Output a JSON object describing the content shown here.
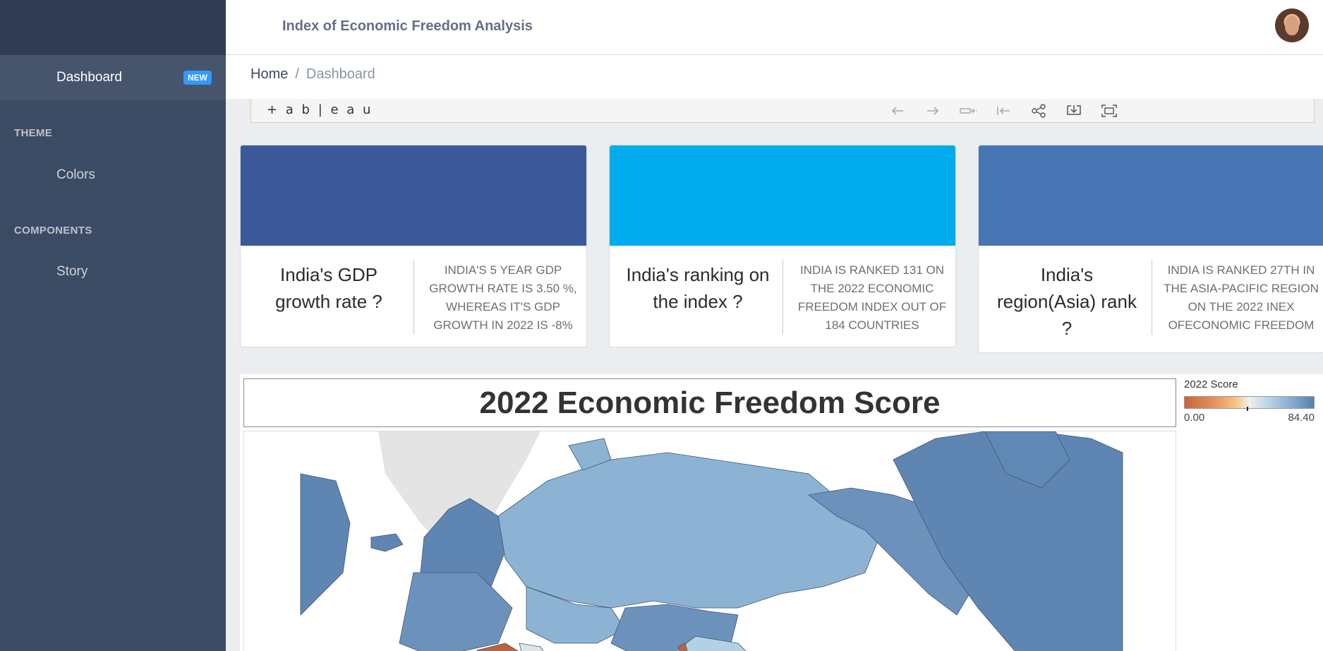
{
  "app": {
    "title": "Index of Economic Freedom Analysis"
  },
  "sidebar": {
    "active_item": {
      "label": "Dashboard",
      "badge": "NEW"
    },
    "sections": [
      {
        "title": "THEME",
        "items": [
          "Colors"
        ]
      },
      {
        "title": "COMPONENTS",
        "items": [
          "Story"
        ]
      }
    ]
  },
  "breadcrumb": {
    "home": "Home",
    "separator": "/",
    "current": "Dashboard"
  },
  "tableau": {
    "logo": "+ a b | e a u",
    "toolbar_icons": [
      "undo-icon",
      "redo-icon",
      "revert-icon",
      "revert-dropdown-icon",
      "reset-icon",
      "share-icon",
      "download-icon",
      "fullscreen-icon"
    ]
  },
  "cards": [
    {
      "question": "India's GDP growth rate ?",
      "answer": "INDIA'S 5 YEAR GDP GROWTH RATE IS 3.50 %, WHEREAS IT'S GDP GROWTH IN 2022 IS -8%",
      "color": "#3b5998"
    },
    {
      "question": "India's ranking on the index ?",
      "answer": "INDIA IS RANKED 131 ON THE 2022 ECONOMIC FREEDOM INDEX OUT OF 184 COUNTRIES",
      "color": "#00aced"
    },
    {
      "question": "India's region(Asia) rank ?",
      "answer": "INDIA IS RANKED 27TH IN THE ASIA-PACIFIC REGION ON THE 2022 INEX OFECONOMIC FREEDOM",
      "color": "#4875b4"
    }
  ],
  "map": {
    "title": "2022 Economic Freedom Score",
    "legend": {
      "title": "2022 Score",
      "min": "0.00",
      "max": "84.40"
    }
  }
}
